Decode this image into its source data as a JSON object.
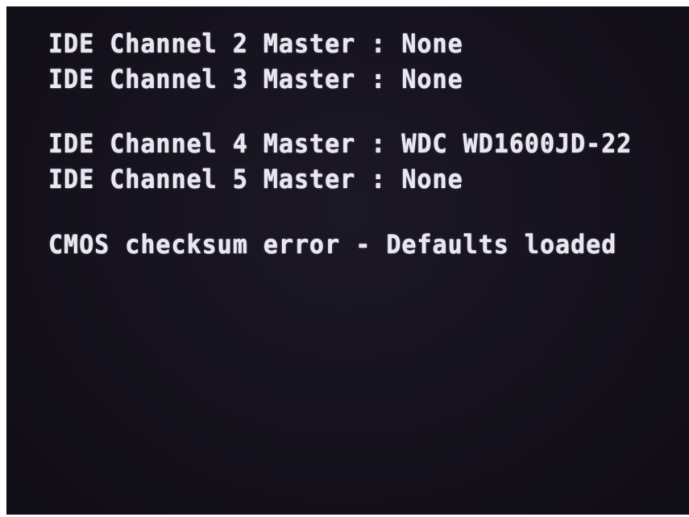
{
  "bios_screen": {
    "lines": [
      "IDE Channel 2 Master : None",
      "IDE Channel 3 Master : None",
      "IDE Channel 4 Master : WDC WD1600JD-22",
      "IDE Channel 5 Master : None",
      "CMOS checksum error - Defaults loaded"
    ]
  },
  "colors": {
    "background": "#15121d",
    "text": "#e9e6f2",
    "border": "#ffffff"
  }
}
